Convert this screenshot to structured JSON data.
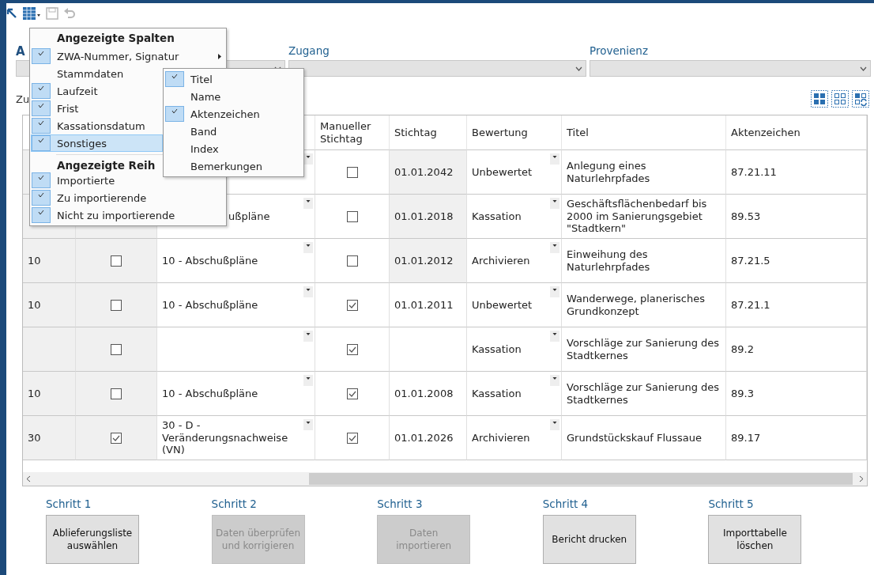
{
  "toolbar": [
    {
      "kind": "columns",
      "disabled": false
    },
    {
      "kind": "save",
      "disabled": true
    },
    {
      "kind": "undo",
      "disabled": true
    }
  ],
  "filters": [
    {
      "label": "A"
    },
    {
      "label": "Zugang"
    },
    {
      "label": "Provenienz"
    }
  ],
  "section_label": "Zu",
  "table": {
    "columns": [
      {
        "label": "Manueller Stichtag"
      },
      {
        "label": "Stichtag"
      },
      {
        "label": "Bewertung"
      },
      {
        "label": "Titel"
      },
      {
        "label": "Aktenzeichen"
      }
    ],
    "rows": [
      {
        "manual": false,
        "stichtag": "01.01.2042",
        "bewertung": "Unbewertet",
        "titel": "Anlegung eines Naturlehrpfades",
        "aktenzeichen": "87.21.11"
      },
      {
        "col3": "ußpläne",
        "col3_covered": true,
        "manual": false,
        "stichtag": "01.01.2018",
        "bewertung": "Kassation",
        "titel": "Geschäftsflächenbedarf bis 2000 im Sanierungsgebiet \"Stadtkern\"",
        "aktenzeichen": "89.53"
      },
      {
        "col1": "10",
        "col2_checked": false,
        "col3": "10 - Abschußpläne",
        "manual": false,
        "stichtag": "01.01.2012",
        "bewertung": "Archivieren",
        "titel": "Einweihung des Naturlehrpfades",
        "aktenzeichen": "87.21.5"
      },
      {
        "col1": "10",
        "col2_checked": false,
        "col3": "10 - Abschußpläne",
        "manual": true,
        "stichtag": "01.01.2011",
        "bewertung": "Unbewertet",
        "titel": "Wanderwege, planerisches Grundkonzept",
        "aktenzeichen": "87.21.1"
      },
      {
        "col2_checked": false,
        "manual": true,
        "bewertung": "Kassation",
        "titel": "Vorschläge zur Sanierung des Stadtkernes",
        "aktenzeichen": "89.2"
      },
      {
        "col1": "10",
        "col2_checked": false,
        "col3": "10 - Abschußpläne",
        "manual": true,
        "stichtag": "01.01.2008",
        "bewertung": "Kassation",
        "titel": "Vorschläge zur Sanierung des Stadtkernes",
        "aktenzeichen": "89.3"
      },
      {
        "col1": "30",
        "col2_checked": true,
        "col3": "30 - D - Veränderungsnachweise (VN)",
        "manual": true,
        "stichtag": "01.01.2026",
        "bewertung": "Archivieren",
        "titel": "Grundstückskauf Flussaue",
        "aktenzeichen": "89.17"
      }
    ]
  },
  "menu": {
    "sections": [
      {
        "title": "Angezeigte Spalten",
        "items": [
          {
            "label": "ZWA-Nummer, Signatur",
            "checked": true,
            "selected": false,
            "has_submenu": true
          },
          {
            "label": "Stammdaten",
            "checked": false,
            "selected": false,
            "has_submenu": false
          },
          {
            "label": "Laufzeit",
            "checked": true,
            "selected": false,
            "has_submenu": false
          },
          {
            "label": "Frist",
            "checked": true,
            "selected": false,
            "has_submenu": false
          },
          {
            "label": "Kassationsdatum",
            "checked": true,
            "selected": false,
            "has_submenu": false
          },
          {
            "label": "Sonstiges",
            "checked": true,
            "selected": true,
            "has_submenu": false
          }
        ]
      },
      {
        "title": "Angezeigte Reih",
        "items": [
          {
            "label": "Importierte",
            "checked": true,
            "selected": false,
            "has_submenu": false
          },
          {
            "label": "Zu importierende",
            "checked": true,
            "selected": false,
            "has_submenu": false
          },
          {
            "label": "Nicht zu importierende",
            "checked": true,
            "selected": false,
            "has_submenu": false
          }
        ]
      }
    ],
    "submenu": [
      {
        "label": "Titel",
        "checked": true
      },
      {
        "label": "Name",
        "checked": false
      },
      {
        "label": "Aktenzeichen",
        "checked": true
      },
      {
        "label": "Band",
        "checked": false
      },
      {
        "label": "Index",
        "checked": false
      },
      {
        "label": "Bemerkungen",
        "checked": false
      }
    ]
  },
  "steps": [
    {
      "label": "Schritt 1",
      "button": "Ablieferungsliste auswählen",
      "disabled": false
    },
    {
      "label": "Schritt 2",
      "button": "Daten überprüfen und korrigieren",
      "disabled": true
    },
    {
      "label": "Schritt 3",
      "button": "Daten importieren",
      "disabled": true
    },
    {
      "label": "Schritt 4",
      "button": "Bericht drucken",
      "disabled": false
    },
    {
      "label": "Schritt 5",
      "button": "Importtabelle löschen",
      "disabled": false
    }
  ]
}
